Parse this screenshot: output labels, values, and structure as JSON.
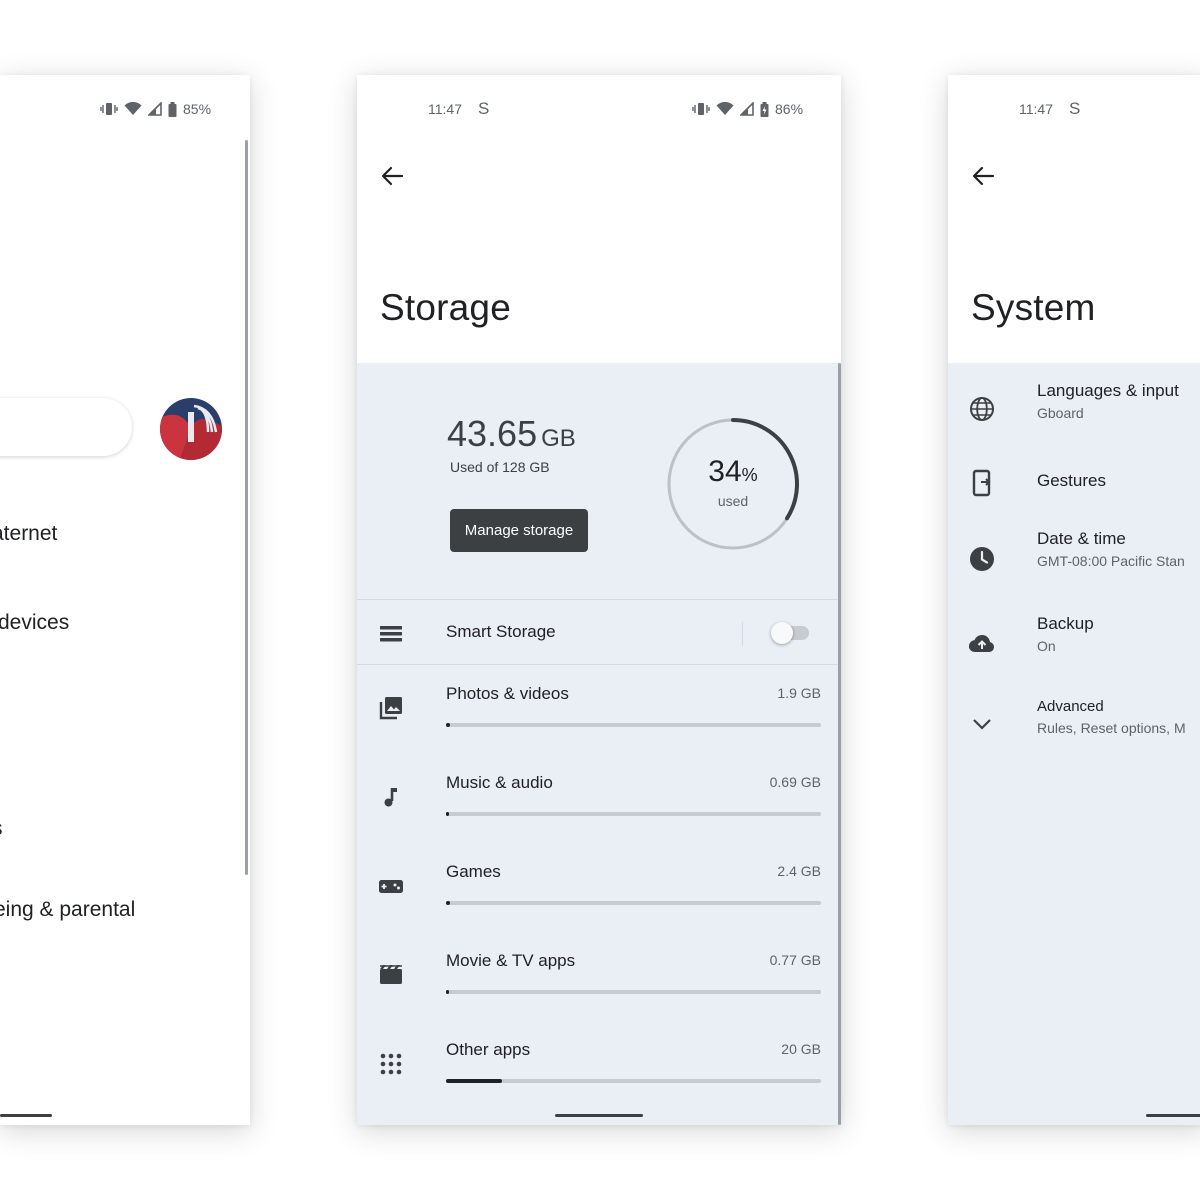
{
  "left_screen": {
    "status": {
      "battery": "85%"
    },
    "items": [
      "aternet",
      "devices",
      "s",
      "eing & parental"
    ]
  },
  "storage_screen": {
    "status": {
      "time": "11:47",
      "s_icon": "S",
      "battery": "86%"
    },
    "title": "Storage",
    "used": {
      "amount": "43.65",
      "unit": "GB",
      "of_text": "Used of 128 GB"
    },
    "manage_button": "Manage storage",
    "ring": {
      "percent": "34",
      "percent_sign": "%",
      "label": "used",
      "fraction": 0.34
    },
    "smart_storage": {
      "label": "Smart Storage",
      "enabled": false
    },
    "categories": [
      {
        "label": "Photos & videos",
        "size": "1.9 GB",
        "fill": 0.01,
        "icon": "photo-library-icon"
      },
      {
        "label": "Music & audio",
        "size": "0.69 GB",
        "fill": 0.0,
        "icon": "music-note-icon"
      },
      {
        "label": "Games",
        "size": "2.4 GB",
        "fill": 0.01,
        "icon": "gamepad-icon"
      },
      {
        "label": "Movie & TV apps",
        "size": "0.77 GB",
        "fill": 0.0,
        "icon": "movie-icon"
      },
      {
        "label": "Other apps",
        "size": "20 GB",
        "fill": 0.15,
        "icon": "apps-grid-icon"
      }
    ]
  },
  "system_screen": {
    "status": {
      "time": "11:47",
      "s_icon": "S"
    },
    "title": "System",
    "items": [
      {
        "title": "Languages & input",
        "subtitle": "Gboard",
        "icon": "globe-icon"
      },
      {
        "title": "Gestures",
        "subtitle": "",
        "icon": "gestures-phone-icon"
      },
      {
        "title": "Date & time",
        "subtitle": "GMT-08:00 Pacific Stan",
        "icon": "clock-icon"
      },
      {
        "title": "Backup",
        "subtitle": "On",
        "icon": "cloud-upload-icon"
      },
      {
        "title": "Advanced",
        "subtitle": "Rules, Reset options, M",
        "icon": "chevron-down-icon"
      }
    ]
  },
  "colors": {
    "content_bg": "#eaeef5",
    "dark": "#3c4043",
    "text": "#202124",
    "secondary": "#5f6368"
  }
}
